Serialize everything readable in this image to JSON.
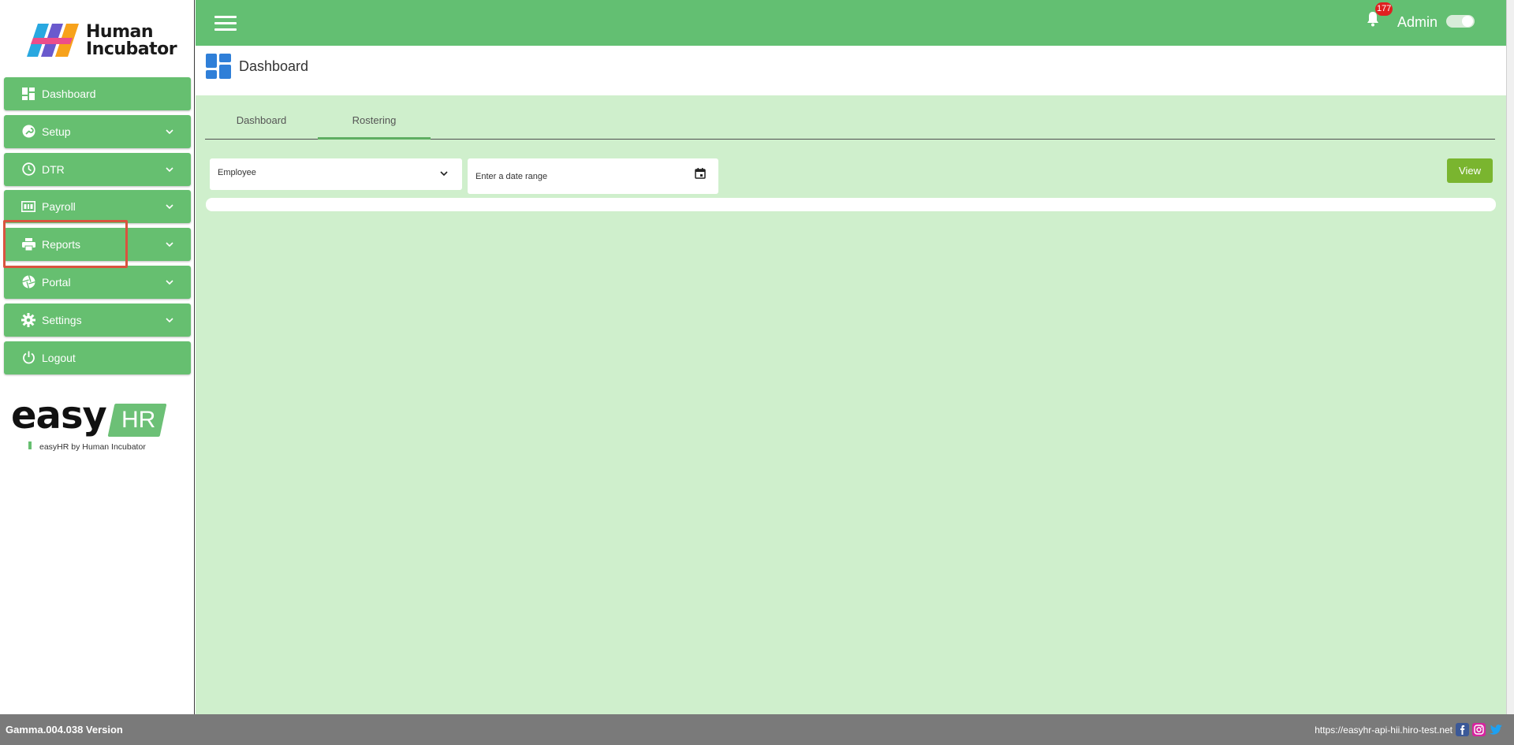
{
  "brand": {
    "name_line1": "Human",
    "name_line2": "Incubator"
  },
  "sidebar": {
    "items": [
      {
        "label": "Dashboard",
        "icon": "dashboard-icon",
        "has_chevron": false
      },
      {
        "label": "Setup",
        "icon": "wrench-icon",
        "has_chevron": true
      },
      {
        "label": "DTR",
        "icon": "clock-icon",
        "has_chevron": true
      },
      {
        "label": "Payroll",
        "icon": "payroll-icon",
        "has_chevron": true
      },
      {
        "label": "Reports",
        "icon": "printer-icon",
        "has_chevron": true
      },
      {
        "label": "Portal",
        "icon": "aperture-icon",
        "has_chevron": true
      },
      {
        "label": "Settings",
        "icon": "gear-icon",
        "has_chevron": true
      },
      {
        "label": "Logout",
        "icon": "power-icon",
        "has_chevron": false
      }
    ],
    "highlighted_item": "Reports"
  },
  "easyhr": {
    "word": "easy",
    "badge": "HR",
    "tagline": "easyHR by Human Incubator"
  },
  "topbar": {
    "notification_count": "177",
    "user": "Admin"
  },
  "page": {
    "title": "Dashboard"
  },
  "tabs": [
    {
      "label": "Dashboard",
      "active": false
    },
    {
      "label": "Rostering",
      "active": true
    }
  ],
  "filters": {
    "employee_placeholder": "Employee",
    "date_range_placeholder": "Enter a date range",
    "view_label": "View"
  },
  "footer": {
    "version": "Gamma.004.038 Version",
    "url": "https://easyhr-api-hii.hiro-test.net"
  },
  "colors": {
    "primary_green": "#63bf72",
    "content_bg": "#cfefcc",
    "view_button": "#7ab52f",
    "badge_red": "#e02020",
    "highlight_red": "#d9533f",
    "footer_bg": "#7a7a7a"
  }
}
